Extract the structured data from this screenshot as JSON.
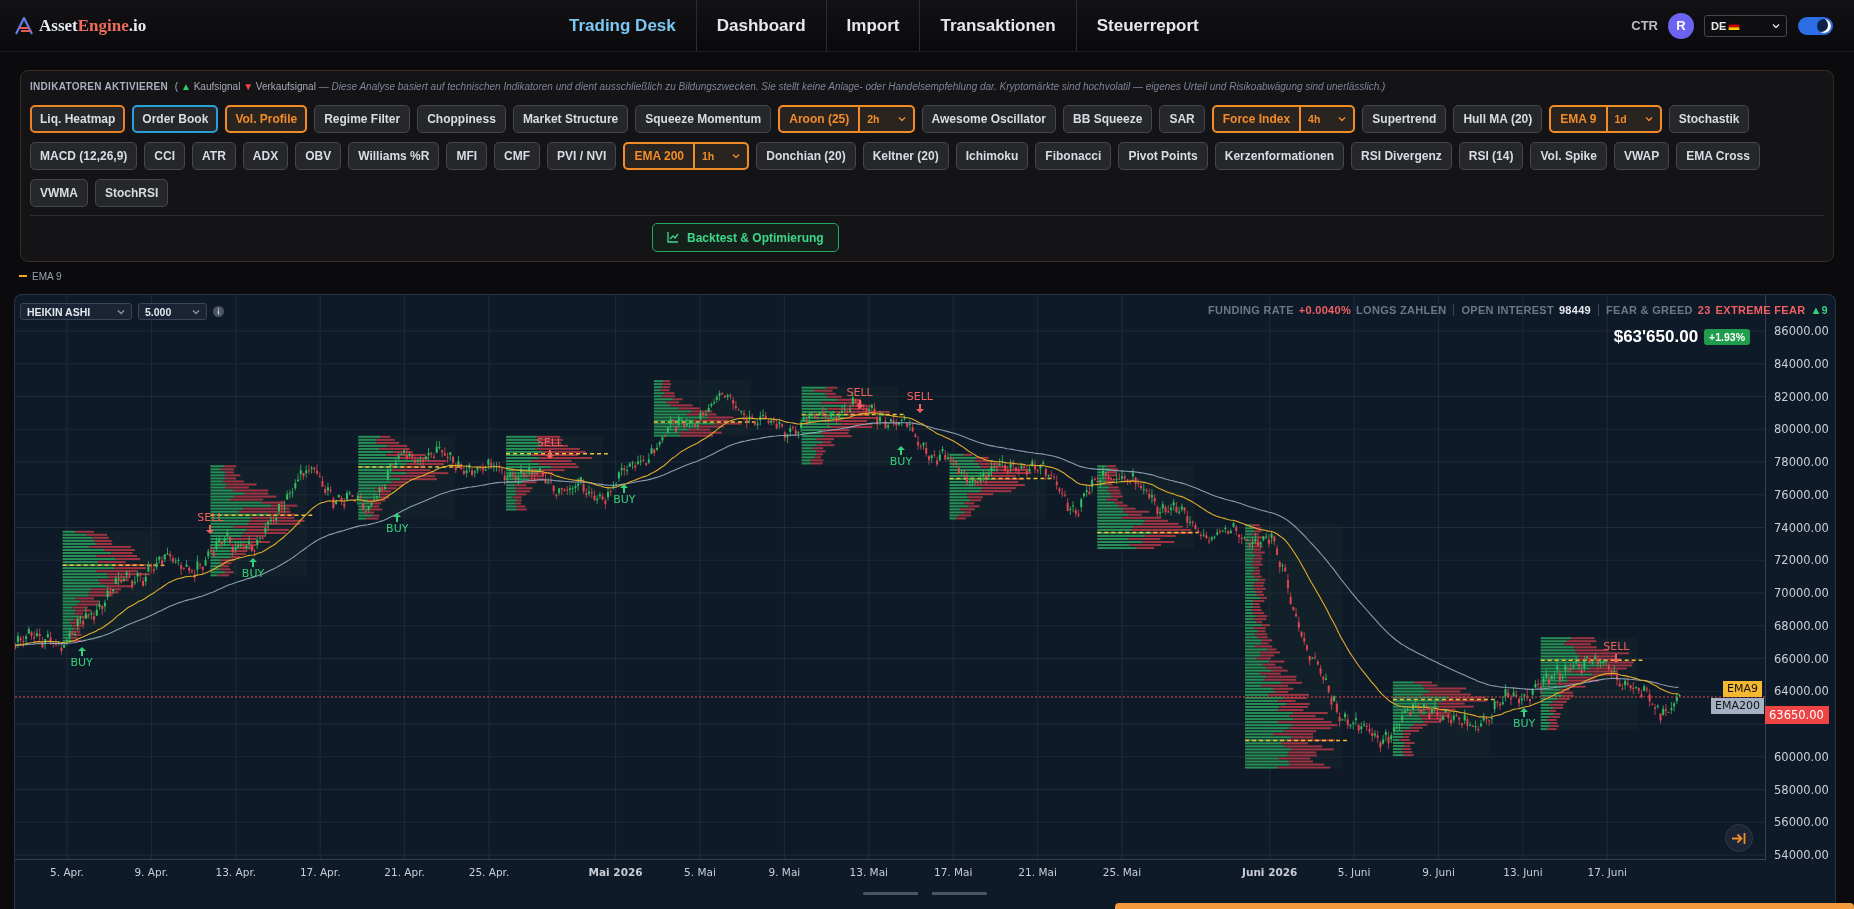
{
  "header": {
    "logo": {
      "part_1": "Asset",
      "part_2": "Engine",
      "part_3": ".io"
    },
    "nav": [
      {
        "label": "Trading Desk",
        "selected": true
      },
      {
        "label": "Dashboard",
        "selected": false
      },
      {
        "label": "Import",
        "selected": false
      },
      {
        "label": "Transaktionen",
        "selected": false
      },
      {
        "label": "Steuerreport",
        "selected": false
      }
    ],
    "user_code": "CTR",
    "avatar": "R",
    "language": "DE",
    "theme_toggle": {
      "on": true
    }
  },
  "indicators": {
    "title": "INDIKATOREN AKTIVIEREN",
    "legend": {
      "open": "(",
      "buy_mark": "▲",
      "buy": "Kaufsignal",
      "sell_mark": "▼",
      "sell": "Verkaufsignal",
      "disclaimer": "— Diese Analyse basiert auf technischen Indikatoren und dient ausschließlich zu Bildungszwecken. Sie stellt keine Anlage- oder Handelsempfehlung dar. Kryptomärkte sind hochvolatil — eigenes Urteil und Risikoabwägung sind unerlässlich.)"
    },
    "buttons": [
      {
        "label": "Liq. Heatmap",
        "kind": "overlay",
        "active": true,
        "color": "#e8832a"
      },
      {
        "label": "Order Book",
        "kind": "overlay",
        "active": true,
        "color": "#2a9fd6"
      },
      {
        "label": "Vol. Profile",
        "kind": "toggle",
        "active": true,
        "color": "#f28c28"
      },
      {
        "label": "Regime Filter",
        "kind": "toggle",
        "active": false
      },
      {
        "label": "Choppiness",
        "kind": "toggle",
        "active": false
      },
      {
        "label": "Market Structure",
        "kind": "toggle",
        "active": false
      },
      {
        "label": "Squeeze Momentum",
        "kind": "toggle",
        "active": false
      },
      {
        "label": "Aroon (25)",
        "kind": "split",
        "active": true,
        "color": "#f28c28",
        "timeframe": "2h"
      },
      {
        "label": "Awesome Oscillator",
        "kind": "toggle",
        "active": false
      },
      {
        "label": "BB Squeeze",
        "kind": "toggle",
        "active": false
      },
      {
        "label": "SAR",
        "kind": "toggle",
        "active": false
      },
      {
        "label": "Force Index",
        "kind": "split",
        "active": true,
        "color": "#f28c28",
        "timeframe": "4h"
      },
      {
        "label": "Supertrend",
        "kind": "toggle",
        "active": false
      },
      {
        "label": "Hull MA (20)",
        "kind": "toggle",
        "active": false
      },
      {
        "label": "EMA 9",
        "kind": "split",
        "active": true,
        "color": "#f28c28",
        "timeframe": "1d"
      },
      {
        "label": "Stochastik",
        "kind": "toggle",
        "active": false
      },
      {
        "label": "MACD (12,26,9)",
        "kind": "toggle",
        "active": false
      },
      {
        "label": "CCI",
        "kind": "toggle",
        "active": false
      },
      {
        "label": "ATR",
        "kind": "toggle",
        "active": false
      },
      {
        "label": "ADX",
        "kind": "toggle",
        "active": false
      },
      {
        "label": "OBV",
        "kind": "toggle",
        "active": false
      },
      {
        "label": "Williams %R",
        "kind": "toggle",
        "active": false
      },
      {
        "label": "MFI",
        "kind": "toggle",
        "active": false
      },
      {
        "label": "CMF",
        "kind": "toggle",
        "active": false
      },
      {
        "label": "PVI / NVI",
        "kind": "toggle",
        "active": false
      },
      {
        "label": "EMA 200",
        "kind": "split",
        "active": true,
        "color": "#f28c28",
        "timeframe": "1h"
      },
      {
        "label": "Donchian (20)",
        "kind": "toggle",
        "active": false
      },
      {
        "label": "Keltner (20)",
        "kind": "toggle",
        "active": false
      },
      {
        "label": "Ichimoku",
        "kind": "toggle",
        "active": false
      },
      {
        "label": "Fibonacci",
        "kind": "toggle",
        "active": false
      },
      {
        "label": "Pivot Points",
        "kind": "toggle",
        "active": false
      },
      {
        "label": "Kerzenformationen",
        "kind": "toggle",
        "active": false
      },
      {
        "label": "RSI Divergenz",
        "kind": "toggle",
        "active": false
      },
      {
        "label": "RSI (14)",
        "kind": "toggle",
        "active": false
      },
      {
        "label": "Vol. Spike",
        "kind": "toggle",
        "active": false
      },
      {
        "label": "VWAP",
        "kind": "toggle",
        "active": false
      },
      {
        "label": "EMA Cross",
        "kind": "toggle",
        "active": false
      },
      {
        "label": "VWMA",
        "kind": "toggle",
        "active": false
      },
      {
        "label": "StochRSI",
        "kind": "toggle",
        "active": false
      }
    ],
    "backtest": "Backtest & Optimierung"
  },
  "legend": {
    "label": "EMA 9"
  },
  "chart": {
    "chart_type": "HEIKIN ASHI",
    "scale": "5.000",
    "stats": [
      {
        "kind": "funding",
        "label": "FUNDING RATE",
        "value": "+0.0040%",
        "note": "LONGS ZAHLEN"
      },
      {
        "kind": "interest",
        "label": "OPEN INTEREST",
        "value": "98449"
      },
      {
        "kind": "sentiment",
        "label": "FEAR & GREED",
        "value": "23",
        "note": "EXTREME FEAR",
        "trend": "▲9"
      }
    ],
    "price": "$63'650.00",
    "change": "+1.93%",
    "y_labels": [
      "86000.00",
      "84000.00",
      "82000.00",
      "80000.00",
      "78000.00",
      "76000.00",
      "74000.00",
      "72000.00",
      "70000.00",
      "68000.00",
      "66000.00",
      "64000.00",
      "60000.00",
      "58000.00",
      "56000.00",
      "54000.00"
    ],
    "tags": [
      {
        "label": "EMA9",
        "kind": "fast"
      },
      {
        "label": "EMA200",
        "kind": "slow"
      }
    ],
    "last_price": "63650.00",
    "x_labels": [
      {
        "label": "5. Apr.",
        "month_start": false
      },
      {
        "label": "9. Apr.",
        "month_start": false
      },
      {
        "label": "13. Apr.",
        "month_start": false
      },
      {
        "label": "17. Apr.",
        "month_start": false
      },
      {
        "label": "21. Apr.",
        "month_start": false
      },
      {
        "label": "25. Apr.",
        "month_start": false
      },
      {
        "label": "Mai 2026",
        "month_start": true
      },
      {
        "label": "5. Mai",
        "month_start": false
      },
      {
        "label": "9. Mai",
        "month_start": false
      },
      {
        "label": "13. Mai",
        "month_start": false
      },
      {
        "label": "17. Mai",
        "month_start": false
      },
      {
        "label": "21. Mai",
        "month_start": false
      },
      {
        "label": "25. Mai",
        "month_start": false
      },
      {
        "label": "Juni 2026",
        "month_start": true
      },
      {
        "label": "5. Juni",
        "month_start": false
      },
      {
        "label": "9. Juni",
        "month_start": false
      },
      {
        "label": "13. Juni",
        "month_start": false
      },
      {
        "label": "17. Juni",
        "month_start": false
      }
    ],
    "signals": [
      {
        "label": "BUY",
        "kind": "buy"
      },
      {
        "label": "SELL",
        "kind": "sell"
      },
      {
        "label": "BUY",
        "kind": "buy"
      },
      {
        "label": "BUY",
        "kind": "buy"
      },
      {
        "label": "SELL",
        "kind": "sell"
      },
      {
        "label": "BUY",
        "kind": "buy"
      },
      {
        "label": "SELL",
        "kind": "sell"
      },
      {
        "label": "BUY",
        "kind": "buy"
      },
      {
        "label": "SELL",
        "kind": "sell"
      },
      {
        "label": "BUY",
        "kind": "buy"
      },
      {
        "label": "SELL",
        "kind": "sell"
      }
    ]
  }
}
